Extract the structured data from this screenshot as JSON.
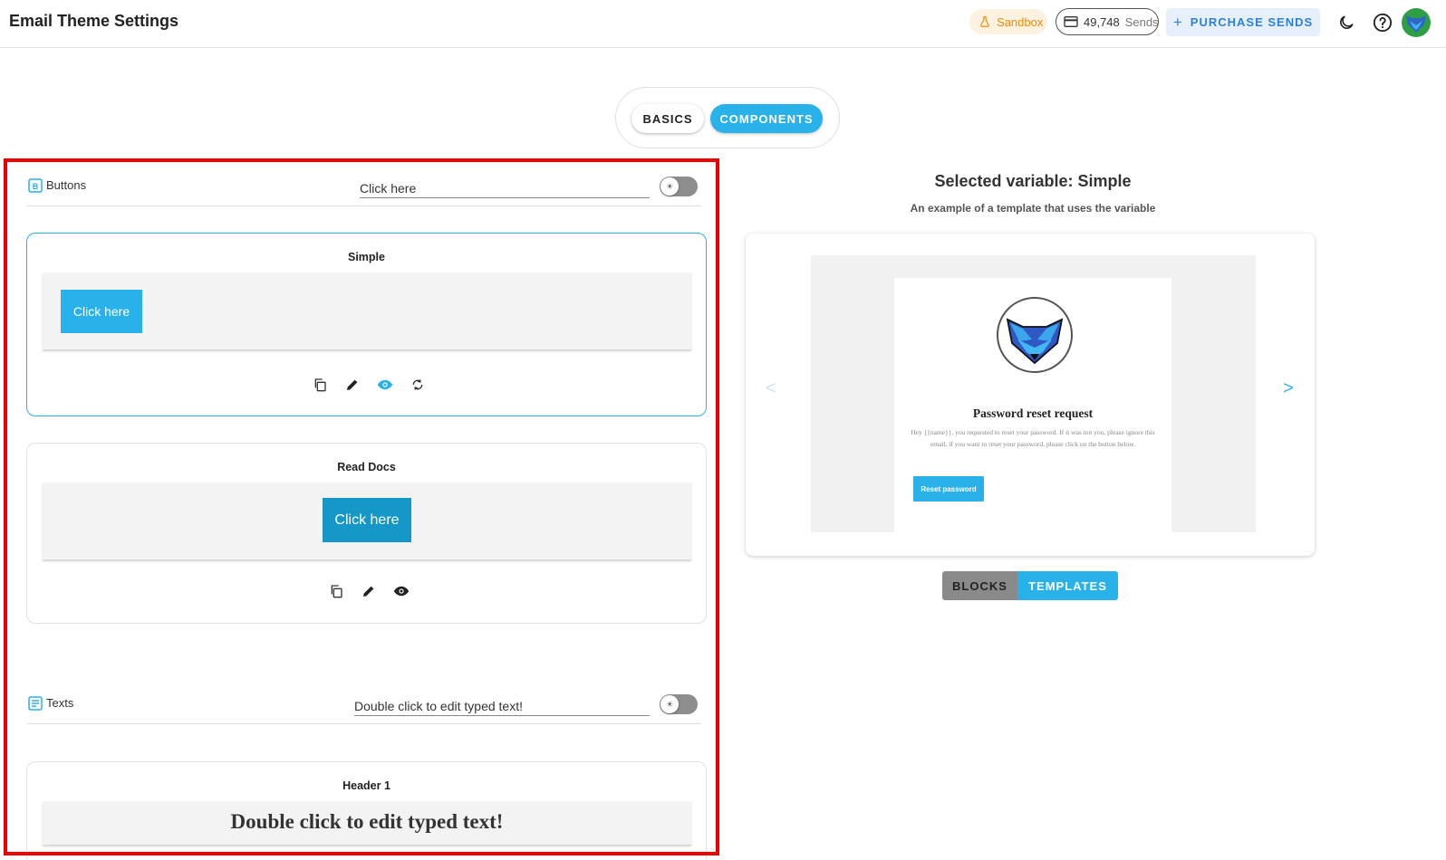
{
  "header": {
    "title": "Email Theme Settings",
    "sandbox_label": "Sandbox",
    "sends_count": "49,748",
    "sends_label": "Sends",
    "purchase_label": "PURCHASE SENDS"
  },
  "tabs": {
    "basics": "BASICS",
    "components": "COMPONENTS",
    "active": "components"
  },
  "buttons_section": {
    "label": "Buttons",
    "input_value": "Click here",
    "toggle_on": false,
    "toggle_symbol": "☀",
    "cards": [
      {
        "title": "Simple",
        "button_label": "Click here",
        "button_color": "#29b2ea",
        "selected": true
      },
      {
        "title": "Read Docs",
        "button_label": "Click here",
        "button_color": "#1597c8",
        "selected": false
      }
    ]
  },
  "texts_section": {
    "label": "Texts",
    "input_value": "Double click to edit typed text!",
    "toggle_on": false,
    "toggle_symbol": "☀",
    "cards": [
      {
        "title": "Header 1",
        "preview_text": "Double click to edit typed text!"
      }
    ]
  },
  "preview": {
    "selected_title": "Selected variable: Simple",
    "subtitle": "An example of a template that uses the variable",
    "prev_symbol": "<",
    "next_symbol": ">",
    "email": {
      "heading": "Password reset request",
      "body": "Hey {{name}}, you requested to reset your password. If it was not you, please ignore this email, if you want to reset your password, please click on the button below.",
      "button_label": "Reset password"
    },
    "mode_buttons": {
      "blocks": "BLOCKS",
      "templates": "TEMPLATES",
      "active": "templates"
    }
  },
  "colors": {
    "accent": "#29b2ea",
    "highlight_frame": "#ee0000",
    "sandbox": "#f08c00",
    "purchase_text": "#2f80d8"
  }
}
